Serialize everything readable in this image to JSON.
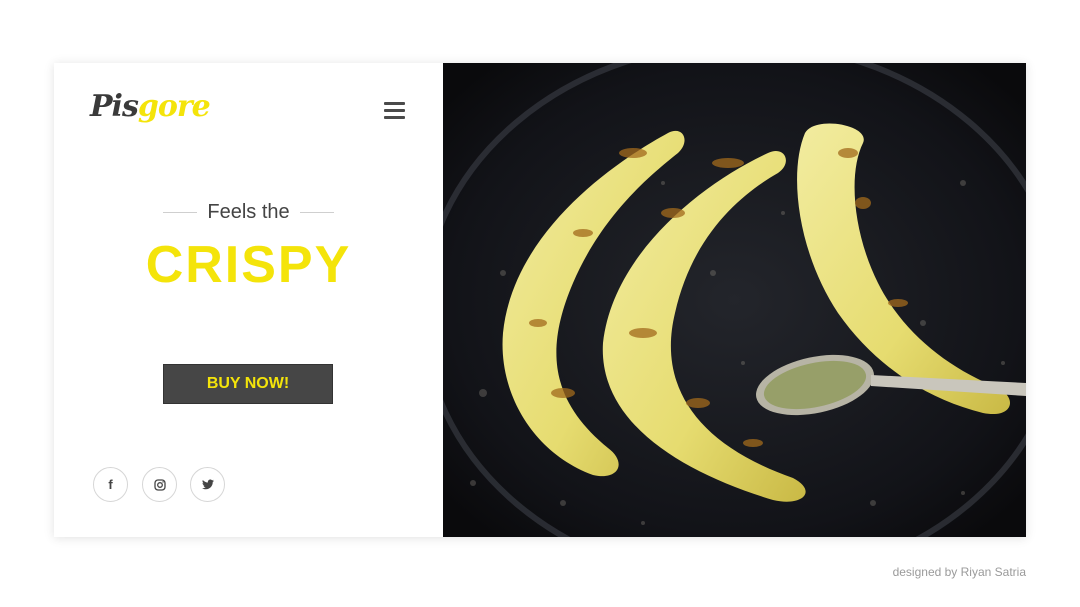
{
  "brand": {
    "logo_part1": "Pis",
    "logo_part2": "gore"
  },
  "hero": {
    "tagline": "Feels the",
    "headline": "CRISPY",
    "cta_label": "BUY NOW!"
  },
  "social": [
    {
      "icon": "facebook-icon",
      "glyph": "f"
    },
    {
      "icon": "instagram-icon"
    },
    {
      "icon": "twitter-icon"
    }
  ],
  "footer": {
    "credit": "designed by Riyan Satria"
  },
  "colors": {
    "accent": "#f4e40a",
    "dark": "#464646",
    "text": "#444444"
  }
}
